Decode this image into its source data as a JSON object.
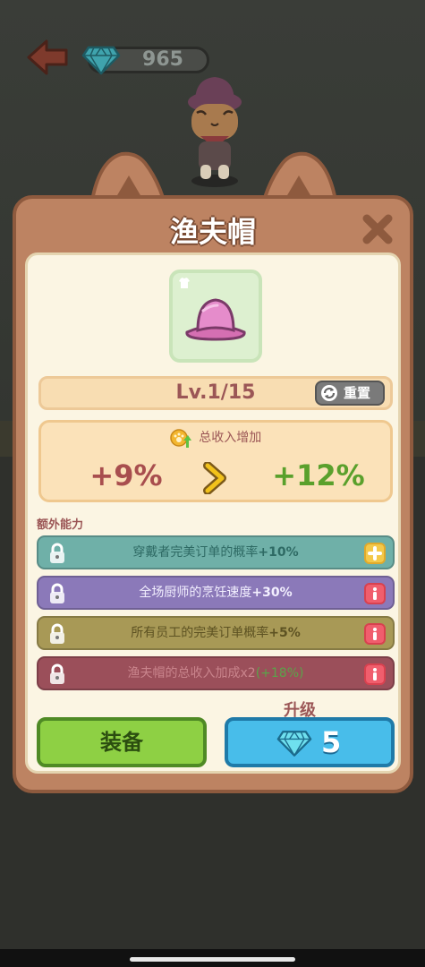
{
  "hud": {
    "gem_count": "965"
  },
  "panel": {
    "title": "渔夫帽"
  },
  "item": {
    "icon": "pink-bucket-hat-icon"
  },
  "level": {
    "text": "Lv.1/15",
    "reset_label": "重置"
  },
  "stat": {
    "title": "总收入增加",
    "current": "+9%",
    "next": "+12%"
  },
  "extra": {
    "label": "额外能力",
    "abilities": [
      {
        "text": "穿戴者完美订单的概率",
        "bonus": "+10%",
        "badge": "plus"
      },
      {
        "text": "全场厨师的烹饪速度",
        "bonus": "+30%",
        "badge": "info"
      },
      {
        "text": "所有员工的完美订单概率",
        "bonus": "+5%",
        "badge": "info"
      },
      {
        "text": "渔夫帽的总收入加成x2",
        "bonus": "(+18%)",
        "badge": "info"
      }
    ]
  },
  "actions": {
    "upgrade_label": "升级",
    "equip_label": "装备",
    "upgrade_cost": "5"
  },
  "colors": {
    "panel_brown": "#bd8362",
    "cream": "#fbf5e3",
    "green_value": "#5aa02c",
    "red_value": "#a84e4e",
    "equip_green": "#8ed044",
    "upgrade_blue": "#48bdea"
  }
}
